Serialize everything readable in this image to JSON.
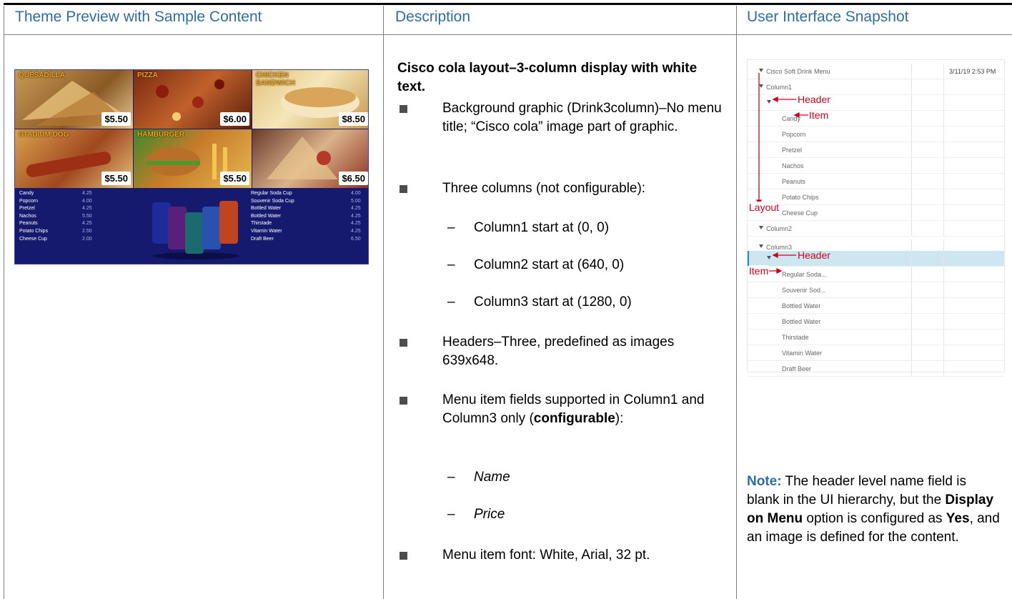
{
  "table": {
    "headers": [
      "Theme Preview with Sample Content",
      "Description",
      "User Interface Snapshot"
    ]
  },
  "preview": {
    "tiles": [
      {
        "label": "QUESADILLA",
        "price": "$5.50"
      },
      {
        "label": "PIZZA",
        "price": "$6.00"
      },
      {
        "label": "CHICKEN SANDWICH",
        "price": "$8.50"
      },
      {
        "label": "STADIUM DOG",
        "price": "$5.50"
      },
      {
        "label": "HAMBURGER",
        "price": "$5.50"
      },
      {
        "label": "",
        "price": "$6.50"
      }
    ],
    "left_menu": [
      {
        "name": "Candy",
        "price": "4.25"
      },
      {
        "name": "Popcorn",
        "price": "4.00"
      },
      {
        "name": "Pretzel",
        "price": "4.25"
      },
      {
        "name": "Nachos",
        "price": "5.50"
      },
      {
        "name": "Peanuts",
        "price": "4.25"
      },
      {
        "name": "Potato Chips",
        "price": "2.50"
      },
      {
        "name": "Cheese Cup",
        "price": "2.00"
      }
    ],
    "right_menu": [
      {
        "name": "Regular Soda Cup",
        "price": "4.00"
      },
      {
        "name": "Souvenir Soda Cup",
        "price": "5.00"
      },
      {
        "name": "Bottled Water",
        "price": "4.25"
      },
      {
        "name": "Bottled Water",
        "price": "4.25"
      },
      {
        "name": "Thirstade",
        "price": "4.25"
      },
      {
        "name": "Vitamin Water",
        "price": "4.25"
      },
      {
        "name": "Draft Beer",
        "price": "6.50"
      }
    ]
  },
  "description": {
    "title": "Cisco cola layout–3-column display with white text.",
    "b1": "Background graphic (Drink3column)–No menu title; “Cisco cola” image part of graphic.",
    "b2": "Three columns (not configurable):",
    "d1": "Column1 start at (0, 0)",
    "d2": "Column2 start at (640, 0)",
    "d3": "Column3 start at (1280, 0)",
    "b3": "Headers–Three, predefined as images 639x648.",
    "b4_pre": "Menu item fields supported in Column1 and Column3 only (",
    "b4_bold": "configurable",
    "b4_post": "):",
    "d4": "Name",
    "d5": "Price",
    "b5": "Menu item font: White, Arial, 32 pt."
  },
  "snapshot": {
    "root": "Cisco Soft Drink Menu",
    "timestamp": "3/11/19 2:53 PM",
    "column1": "Column1",
    "items1": [
      "Candy",
      "Popcorn",
      "Pretzel",
      "Nachos",
      "Peanuts",
      "Potato Chips",
      "Cheese Cup"
    ],
    "column2": "Column2",
    "column3": "Column3",
    "items3": [
      "Regular Soda...",
      "Souvenir Sod...",
      "Bottled Water",
      "Bottled Water",
      "Thirstade",
      "Vitamin Water",
      "Draft Beer"
    ],
    "annotations": {
      "header": "Header",
      "item": "Item",
      "layout": "Layout"
    }
  },
  "note": {
    "label": "Note:",
    "t1": " The header level name field is blank in the UI hierarchy, but the ",
    "b1": "Display on Menu",
    "t2": " option is configured as ",
    "b2": "Yes",
    "t3": ", and an image is defined for the content."
  },
  "colors": {
    "header_text": "#2f6ea5",
    "annotation_red": "#d0021b",
    "menu_bg": "#151a6e",
    "price_gold": "#f2a41c"
  }
}
